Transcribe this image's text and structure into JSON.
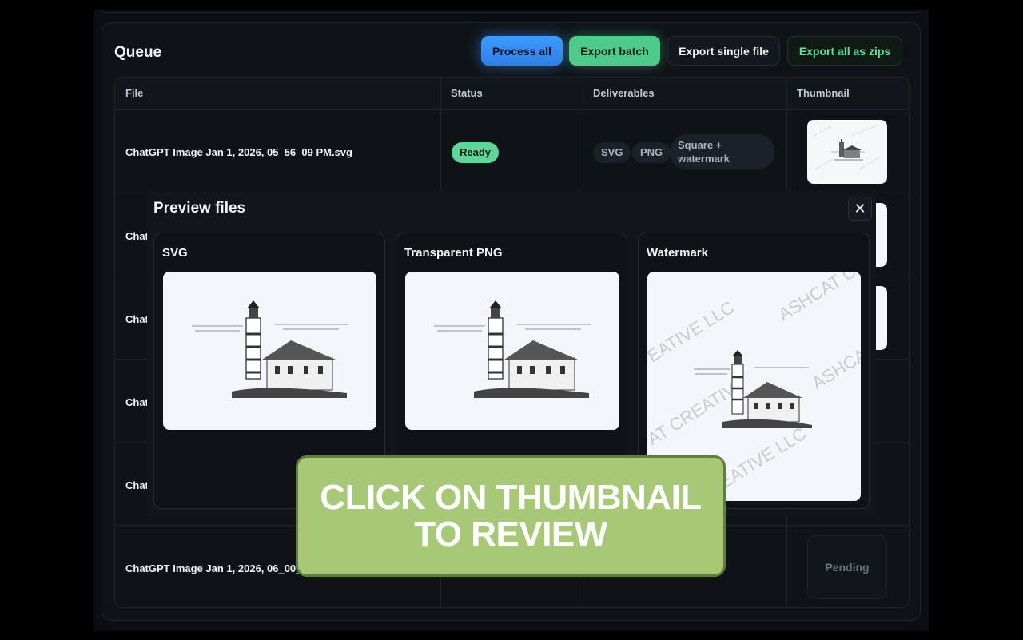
{
  "queue": {
    "title": "Queue",
    "buttons": {
      "process_all": "Process all",
      "export_batch": "Export batch",
      "export_single": "Export single file",
      "export_zips": "Export all as zips"
    },
    "columns": [
      "File",
      "Status",
      "Deliverables",
      "Thumbnail"
    ],
    "rows": [
      {
        "file": "ChatGPT Image Jan 1, 2026, 05_56_09 PM.svg",
        "status": "Ready",
        "deliverables": [
          "SVG",
          "PNG",
          "Square + watermark"
        ]
      },
      {
        "file": "Chat"
      },
      {
        "file": "Chat"
      },
      {
        "file": "Chat"
      },
      {
        "file": "Chat"
      },
      {
        "file": "ChatGPT Image Jan 1, 2026, 06_00_2",
        "thumbnail": "Pending"
      }
    ]
  },
  "modal": {
    "title": "Preview files",
    "close_icon": "close-icon",
    "cards": [
      {
        "title": "SVG"
      },
      {
        "title": "Transparent PNG"
      },
      {
        "title": "Watermark",
        "watermark_text": [
          "ASHCAT CR",
          "EATIVE LLC",
          "ASHCA",
          "AT CREATIV",
          "EATIVE LLC"
        ]
      }
    ]
  },
  "callout": {
    "text": "CLICK ON THUMBNAIL\nTO REVIEW"
  },
  "colors": {
    "primary": "#3d9bff",
    "success": "#4ecb8a",
    "callout": "#a7c876"
  }
}
